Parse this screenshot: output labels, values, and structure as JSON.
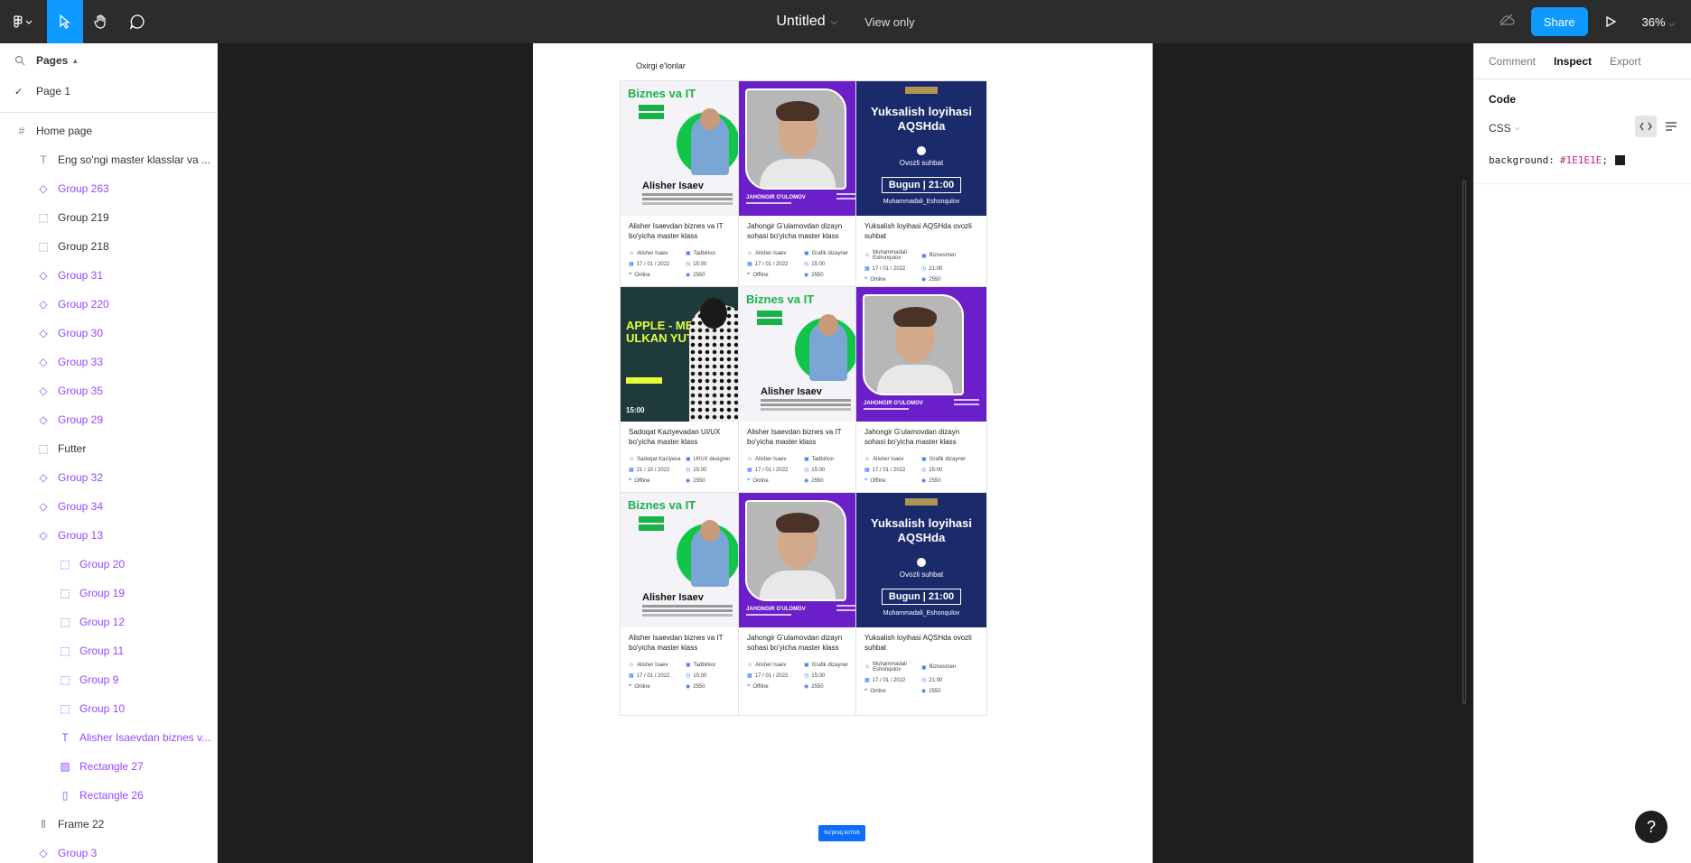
{
  "toolbar": {
    "file_title": "Untitled",
    "view_only": "View only",
    "share_label": "Share",
    "zoom": "36%"
  },
  "left_panel": {
    "pages_label": "Pages",
    "pages": [
      {
        "label": "Page 1",
        "selected": true
      }
    ],
    "layers": [
      {
        "label": "Home page",
        "type": "frame",
        "level": 0,
        "purple": false
      },
      {
        "label": "Eng so'ngi master klasslar va ...",
        "type": "text",
        "level": 1,
        "purple": false
      },
      {
        "label": "Group 263",
        "type": "component",
        "level": 1,
        "purple": true
      },
      {
        "label": "Group 219",
        "type": "group",
        "level": 1,
        "purple": false
      },
      {
        "label": "Group 218",
        "type": "group",
        "level": 1,
        "purple": false
      },
      {
        "label": "Group 31",
        "type": "component",
        "level": 1,
        "purple": true
      },
      {
        "label": "Group 220",
        "type": "component",
        "level": 1,
        "purple": true
      },
      {
        "label": "Group 30",
        "type": "component",
        "level": 1,
        "purple": true
      },
      {
        "label": "Group 33",
        "type": "component",
        "level": 1,
        "purple": true
      },
      {
        "label": "Group 35",
        "type": "component",
        "level": 1,
        "purple": true
      },
      {
        "label": "Group 29",
        "type": "component",
        "level": 1,
        "purple": true
      },
      {
        "label": "Futter",
        "type": "group",
        "level": 1,
        "purple": false
      },
      {
        "label": "Group 32",
        "type": "component",
        "level": 1,
        "purple": true
      },
      {
        "label": "Group 34",
        "type": "component",
        "level": 1,
        "purple": true
      },
      {
        "label": "Group 13",
        "type": "component",
        "level": 1,
        "purple": true
      },
      {
        "label": "Group 20",
        "type": "group",
        "level": 2,
        "purple": true
      },
      {
        "label": "Group 19",
        "type": "group",
        "level": 2,
        "purple": true
      },
      {
        "label": "Group 12",
        "type": "group",
        "level": 2,
        "purple": true
      },
      {
        "label": "Group 11",
        "type": "group",
        "level": 2,
        "purple": true
      },
      {
        "label": "Group 9",
        "type": "group",
        "level": 2,
        "purple": true
      },
      {
        "label": "Group 10",
        "type": "group",
        "level": 2,
        "purple": true
      },
      {
        "label": "Alisher Isaevdan biznes v...",
        "type": "text",
        "level": 2,
        "purple": true
      },
      {
        "label": "Rectangle 27",
        "type": "image",
        "level": 2,
        "purple": true
      },
      {
        "label": "Rectangle 26",
        "type": "rect",
        "level": 2,
        "purple": true
      },
      {
        "label": "Frame 22",
        "type": "columns",
        "level": 1,
        "purple": false
      },
      {
        "label": "Group 3",
        "type": "component",
        "level": 1,
        "purple": true
      }
    ]
  },
  "canvas": {
    "section_title": "Oxirgi e'lonlar",
    "load_more": "Ko'proq ko'rish",
    "cards": [
      {
        "kind": "biz",
        "title": "Alisher Isaevdan biznes va IT bo'yicha master klass",
        "meta": [
          "Alisher Isaev",
          "Tadbirkor",
          "17 / 01 / 2022",
          "15:00",
          "Online",
          "2550"
        ]
      },
      {
        "kind": "jah",
        "title": "Jahongir G'ulamovdan dizayn sohasi bo'yicha master klass",
        "meta": [
          "Alisher Isaev",
          "Grafik dizayner",
          "17 / 01 / 2022",
          "15:00",
          "Offline",
          "2550"
        ]
      },
      {
        "kind": "yuk",
        "title": "Yuksalish loyihasi AQSHda ovozli suhbat",
        "meta": [
          "Muhammadali Eshonqulov",
          "Biznesmen",
          "17 / 01 / 2022",
          "21:00",
          "Online",
          "2550"
        ]
      },
      {
        "kind": "apple",
        "title": "Sadoqat Kaziyevadan UI/UX bo'yicha master klass",
        "meta": [
          "Sadoqat Kaziyeva",
          "UI/UX designer",
          "21 / 10 / 2022",
          "15:00",
          "Offline",
          "2550"
        ]
      },
      {
        "kind": "biz",
        "title": "Alisher Isaevdan biznes va IT bo'yicha master klass",
        "meta": [
          "Alisher Isaev",
          "Tadbirkor",
          "17 / 01 / 2022",
          "15:00",
          "Online",
          "2550"
        ]
      },
      {
        "kind": "jah",
        "title": "Jahongir G'ulamovdan dizayn sohasi bo'yicha master klass",
        "meta": [
          "Alisher Isaev",
          "Grafik dizayner",
          "17 / 01 / 2022",
          "15:00",
          "Offline",
          "2550"
        ]
      },
      {
        "kind": "biz",
        "title": "Alisher Isaevdan biznes va IT bo'yicha master klass",
        "meta": [
          "Alisher Isaev",
          "Tadbirkor",
          "17 / 01 / 2022",
          "15:00",
          "Online",
          "2550"
        ]
      },
      {
        "kind": "jah",
        "title": "Jahongir G'ulamovdan dizayn sohasi bo'yicha master klass",
        "meta": [
          "Alisher Isaev",
          "Grafik dizayner",
          "17 / 01 / 2022",
          "15:00",
          "Offline",
          "2550"
        ]
      },
      {
        "kind": "yuk",
        "title": "Yuksalish loyihasi AQSHda ovozli suhbat",
        "meta": [
          "Muhammadali Eshonqulov",
          "Biznesmen",
          "17 / 01 / 2022",
          "21:00",
          "Online",
          "2550"
        ]
      }
    ],
    "banner_text": {
      "biz_title": "Biznes va IT",
      "biz_name": "Alisher Isaev",
      "jah_name": "JAHONGIR G'ULOMOV",
      "yuk_title": "Yuksalish loyihasi AQSHda",
      "yuk_ovozli": "Ovozli suhbat",
      "yuk_bugun": "Bugun | 21:00",
      "yuk_handle": "Muhammadali_Eshonqulov",
      "apple_text": "APPLE - MENING ULKAN YUTUG'IM",
      "apple_time": "15:00"
    }
  },
  "right_panel": {
    "tabs": [
      {
        "label": "Comment",
        "active": false
      },
      {
        "label": "Inspect",
        "active": true
      },
      {
        "label": "Export",
        "active": false
      }
    ],
    "code_heading": "Code",
    "language": "CSS",
    "code_property": "background:",
    "code_value": "#1E1E1E",
    "code_semicolon": ";",
    "help_label": "?"
  },
  "colors": {
    "accent": "#0d99ff",
    "component_purple": "#9747ff",
    "canvas_bg": "#1e1e1e"
  }
}
